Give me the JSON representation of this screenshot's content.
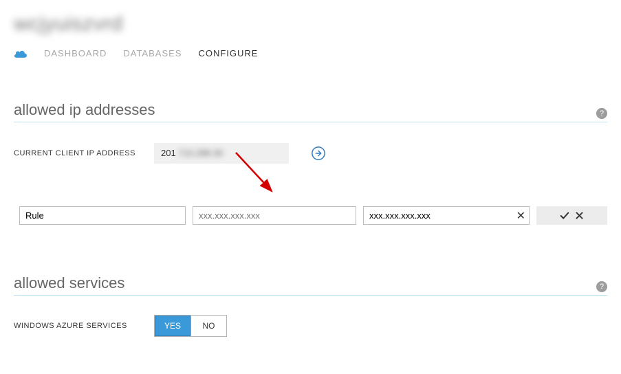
{
  "header": {
    "server_name": "wcjyuiszvrd"
  },
  "tabs": {
    "dashboard": "DASHBOARD",
    "databases": "DATABASES",
    "configure": "CONFIGURE",
    "active": "configure"
  },
  "sections": {
    "ip": {
      "title": "allowed ip addresses",
      "current_label": "CURRENT CLIENT IP ADDRESS",
      "current_value_prefix": "201",
      "current_value_blurred": ".710.288.30",
      "rule": {
        "name_value": "Rule",
        "start_placeholder": "xxx.xxx.xxx.xxx",
        "end_value": "xxx.xxx.xxx.xxx"
      }
    },
    "services": {
      "title": "allowed services",
      "windows_label": "WINDOWS AZURE SERVICES",
      "yes": "YES",
      "no": "NO",
      "selected": "yes"
    }
  },
  "icons": {
    "help": "?",
    "clear": "✕"
  }
}
